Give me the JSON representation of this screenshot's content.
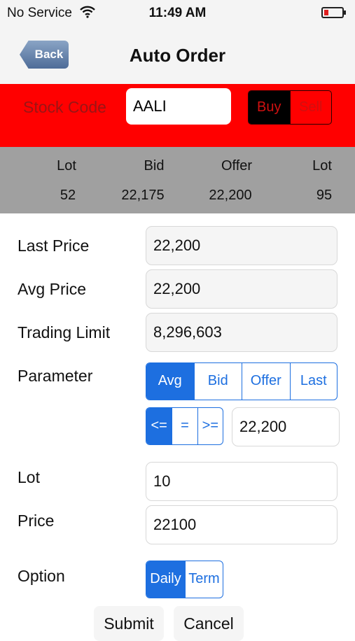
{
  "status": {
    "carrier": "No Service",
    "time": "11:49 AM"
  },
  "nav": {
    "back_label": "Back",
    "title": "Auto Order"
  },
  "order": {
    "stock_code_label": "Stock Code",
    "stock_code_value": "AALI",
    "buy_label": "Buy",
    "sell_label": "Sell"
  },
  "quote": {
    "headers": [
      "Lot",
      "Bid",
      "Offer",
      "Lot"
    ],
    "values": [
      "52",
      "22,175",
      "22,200",
      "95"
    ]
  },
  "info": {
    "last_price_label": "Last Price",
    "last_price_value": "22,200",
    "avg_price_label": "Avg Price",
    "avg_price_value": "22,200",
    "trading_limit_label": "Trading Limit",
    "trading_limit_value": "8,296,603"
  },
  "parameter": {
    "label": "Parameter",
    "options": [
      "Avg",
      "Bid",
      "Offer",
      "Last"
    ],
    "operators": [
      "<=",
      "=",
      ">="
    ],
    "value": "22,200"
  },
  "entry": {
    "lot_label": "Lot",
    "lot_value": "10",
    "price_label": "Price",
    "price_value": "22100"
  },
  "option": {
    "label": "Option",
    "choices": [
      "Daily",
      "Term"
    ]
  },
  "actions": {
    "submit_label": "Submit",
    "cancel_label": "Cancel"
  },
  "colors": {
    "accent": "#1d6fe0",
    "order_bar": "#ff0000",
    "quote_bar": "#a0a0a0"
  }
}
